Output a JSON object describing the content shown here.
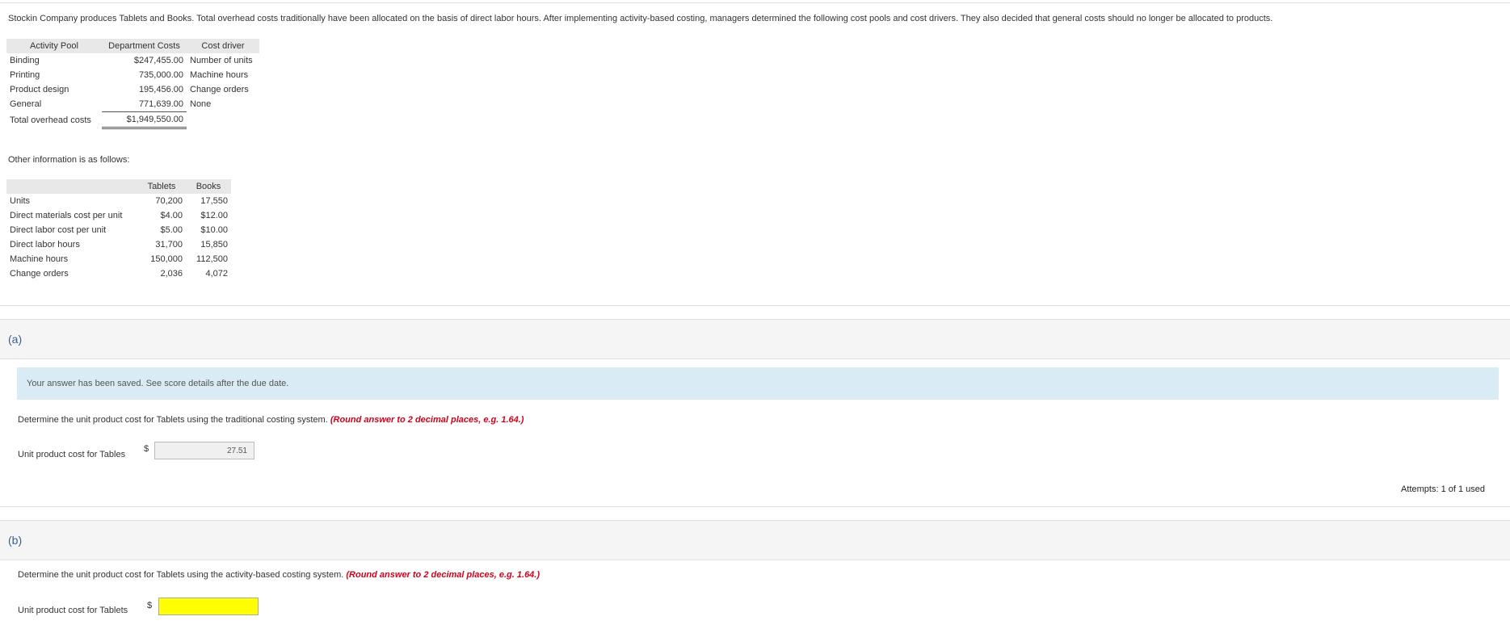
{
  "intro": "Stockin Company produces Tablets and Books. Total overhead costs traditionally have been allocated on the basis of direct labor hours. After implementing activity-based costing, managers determined the following cost pools and cost drivers. They also decided that general costs should no longer be allocated to products.",
  "pool_table": {
    "headers": [
      "Activity Pool",
      "Department Costs",
      "Cost driver"
    ],
    "rows": [
      [
        "Binding",
        "$247,455.00",
        "Number of units"
      ],
      [
        "Printing",
        "735,000.00",
        "Machine hours"
      ],
      [
        "Product design",
        "195,456.00",
        "Change orders"
      ],
      [
        "General",
        "771,639.00",
        "None"
      ]
    ],
    "total": [
      "Total overhead costs",
      "$1,949,550.00"
    ]
  },
  "other_label": "Other information is as follows:",
  "other_table": {
    "headers": [
      "",
      "Tablets",
      "Books"
    ],
    "rows": [
      [
        "Units",
        "70,200",
        "17,550"
      ],
      [
        "Direct materials cost per unit",
        "$4.00",
        "$12.00"
      ],
      [
        "Direct labor cost per unit",
        "$5.00",
        "$10.00"
      ],
      [
        "Direct labor hours",
        "31,700",
        "15,850"
      ],
      [
        "Machine hours",
        "150,000",
        "112,500"
      ],
      [
        "Change orders",
        "2,036",
        "4,072"
      ]
    ]
  },
  "part_a": {
    "label": "(a)",
    "notice": "Your answer has been saved. See score details after the due date.",
    "question": "Determine the unit product cost for Tablets using the traditional costing system.",
    "hint": "(Round answer to 2 decimal places, e.g. 1.64.)",
    "field_label": "Unit product cost for Tables",
    "currency": "$",
    "answer": "27.51",
    "attempts": "Attempts: 1 of 1 used"
  },
  "part_b": {
    "label": "(b)",
    "question": "Determine the unit product cost for Tablets using the activity-based costing system.",
    "hint": "(Round answer to 2 decimal places, e.g. 1.64.)",
    "field_label": "Unit product cost for Tablets",
    "currency": "$",
    "answer": ""
  }
}
